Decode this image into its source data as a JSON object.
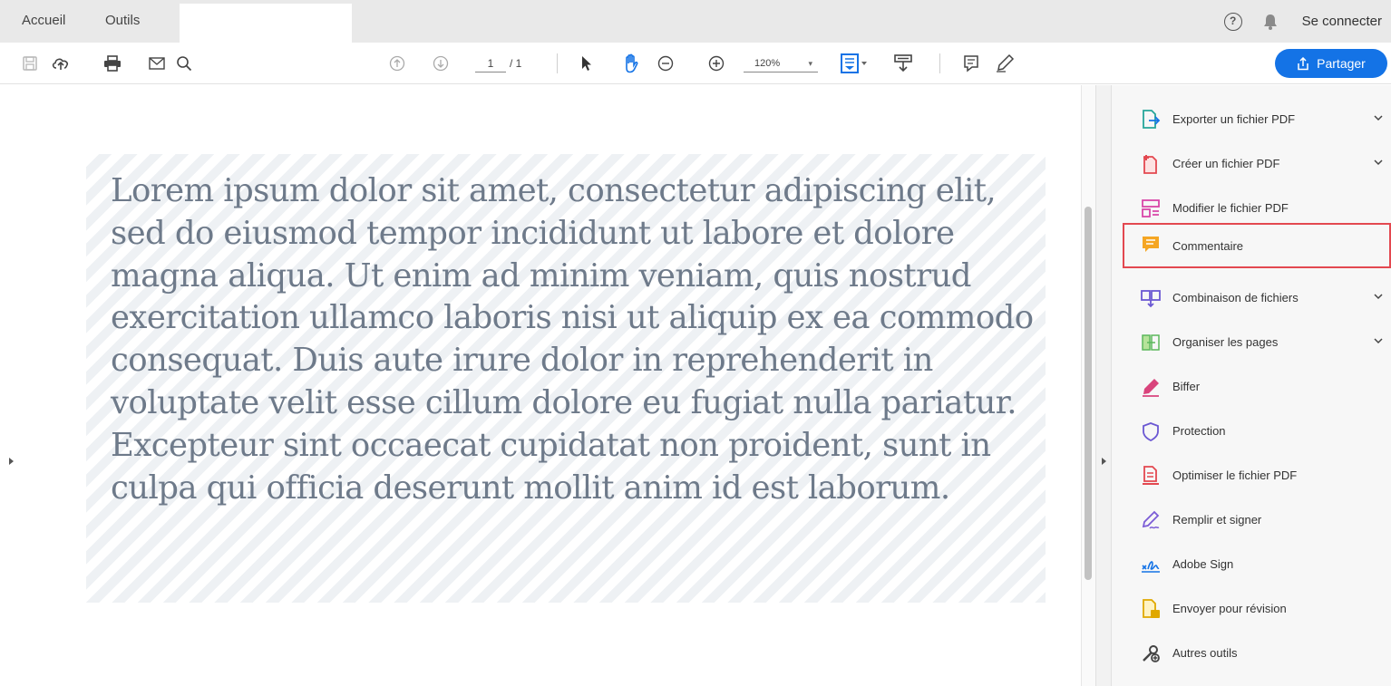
{
  "tabs": {
    "home": "Accueil",
    "tools": "Outils",
    "document": ""
  },
  "topbar": {
    "help_glyph": "?",
    "signin": "Se connecter"
  },
  "toolbar": {
    "page_current": "1",
    "page_total": "/ 1",
    "zoom": "120%",
    "zoom_caret": "▾",
    "share_label": "Partager",
    "icons": [
      "save-icon",
      "upload-cloud-icon",
      "print-icon",
      "email-icon",
      "search-icon",
      "page-up-icon",
      "page-down-icon",
      "select-cursor-icon",
      "hand-tool-icon",
      "zoom-out-icon",
      "zoom-in-icon",
      "fit-page-icon",
      "scroll-mode-icon",
      "comment-icon",
      "highlight-pen-icon",
      "share-icon"
    ]
  },
  "document": {
    "text": "Lorem ipsum dolor sit amet, consectetur adipiscing elit, sed do eiusmod tempor incididunt ut labore et dolore magna aliqua. Ut enim ad minim veniam, quis nostrud exercitation ullamco laboris nisi ut aliquip ex ea commodo consequat. Duis aute irure dolor in reprehenderit in voluptate velit esse cillum dolore eu fugiat nulla pariatur. Excepteur sint occaecat cupidatat non proident, sunt in culpa qui officia deserunt mollit anim id est laborum."
  },
  "tools_pane": {
    "items": [
      {
        "label": "Exporter un fichier PDF",
        "icon": "export-pdf-icon",
        "has_dropdown": true
      },
      {
        "label": "Créer un fichier PDF",
        "icon": "create-pdf-icon",
        "has_dropdown": true
      },
      {
        "label": "Modifier le fichier PDF",
        "icon": "edit-pdf-icon",
        "has_dropdown": false
      },
      {
        "label": "Commentaire",
        "icon": "comment-tool-icon",
        "has_dropdown": false,
        "highlighted": true
      },
      {
        "label": "Combinaison de fichiers",
        "icon": "combine-files-icon",
        "has_dropdown": true
      },
      {
        "label": "Organiser les pages",
        "icon": "organize-pages-icon",
        "has_dropdown": true
      },
      {
        "label": "Biffer",
        "icon": "redact-icon",
        "has_dropdown": false
      },
      {
        "label": "Protection",
        "icon": "shield-icon",
        "has_dropdown": false
      },
      {
        "label": "Optimiser le fichier PDF",
        "icon": "optimize-pdf-icon",
        "has_dropdown": false
      },
      {
        "label": "Remplir et signer",
        "icon": "fill-sign-icon",
        "has_dropdown": false
      },
      {
        "label": "Adobe Sign",
        "icon": "adobe-sign-icon",
        "has_dropdown": false
      },
      {
        "label": "Envoyer pour révision",
        "icon": "send-review-icon",
        "has_dropdown": false
      },
      {
        "label": "Autres outils",
        "icon": "more-tools-icon",
        "has_dropdown": false
      }
    ]
  },
  "colors": {
    "accent_blue": "#1473e6",
    "highlight_border": "#e34850",
    "document_text": "#6e7a8a"
  }
}
